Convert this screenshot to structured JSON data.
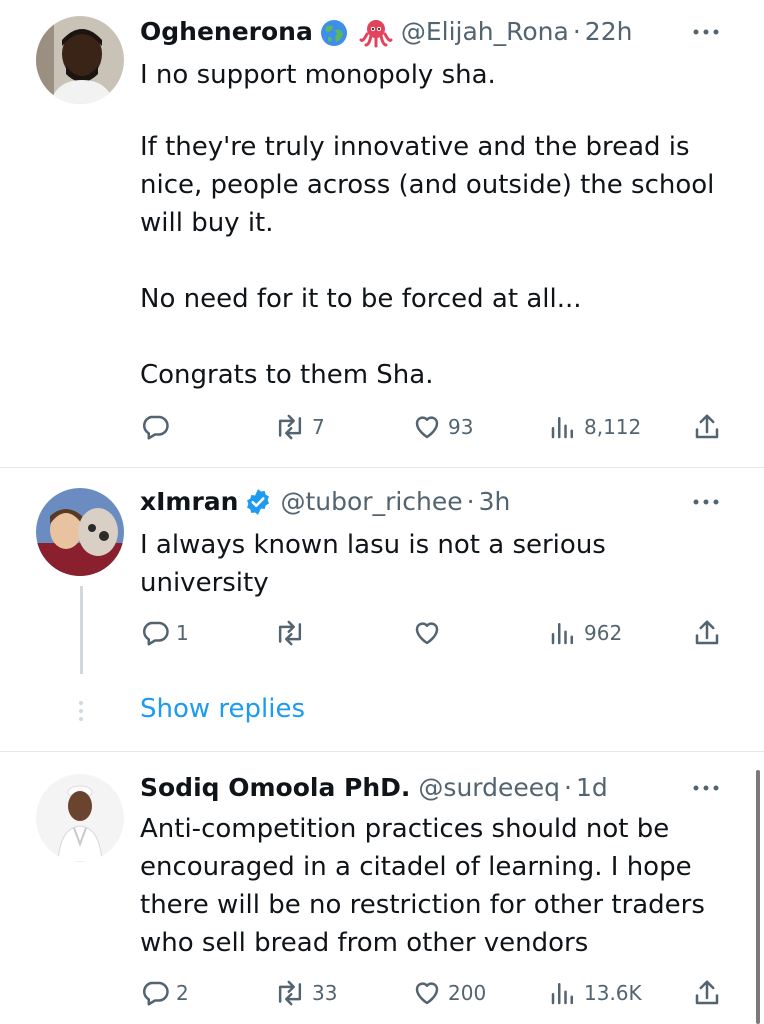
{
  "tweets": [
    {
      "name": "Oghenerona",
      "handle": "@Elijah_Rona",
      "time": "22h",
      "separator": "·",
      "body": [
        "I no support monopoly sha.",
        "If they're truly innovative and the bread is nice, people across (and outside) the school will buy it.",
        "No need for it to be forced at all...",
        "Congrats to them Sha."
      ],
      "replies": "",
      "retweets": "7",
      "likes": "93",
      "views": "8,112"
    },
    {
      "name": "xImran",
      "handle": "@tubor_richee",
      "time": "3h",
      "separator": "·",
      "body": [
        "I always known lasu is not a serious university"
      ],
      "replies": "1",
      "retweets": "",
      "likes": "",
      "views": "962"
    },
    {
      "name": "Sodiq Omoola PhD.",
      "handle": "@surdeeeq",
      "time": "1d",
      "separator": "·",
      "body": [
        "Anti-competition practices should not be encouraged in a citadel of learning. I hope there will be no restriction for other traders who sell bread from other vendors"
      ],
      "replies": "2",
      "retweets": "33",
      "likes": "200",
      "views": "13.6K"
    }
  ],
  "show_replies": "Show replies",
  "colors": {
    "text": "#0f1419",
    "secondary": "#536471",
    "link": "#1d9bf0",
    "verified": "#1d9bf0",
    "divider": "#e1e8ed"
  },
  "icons": [
    "globe-icon",
    "octopus-icon",
    "verified-badge-icon",
    "more-icon",
    "reply-icon",
    "retweet-icon",
    "like-icon",
    "views-icon",
    "share-icon"
  ]
}
